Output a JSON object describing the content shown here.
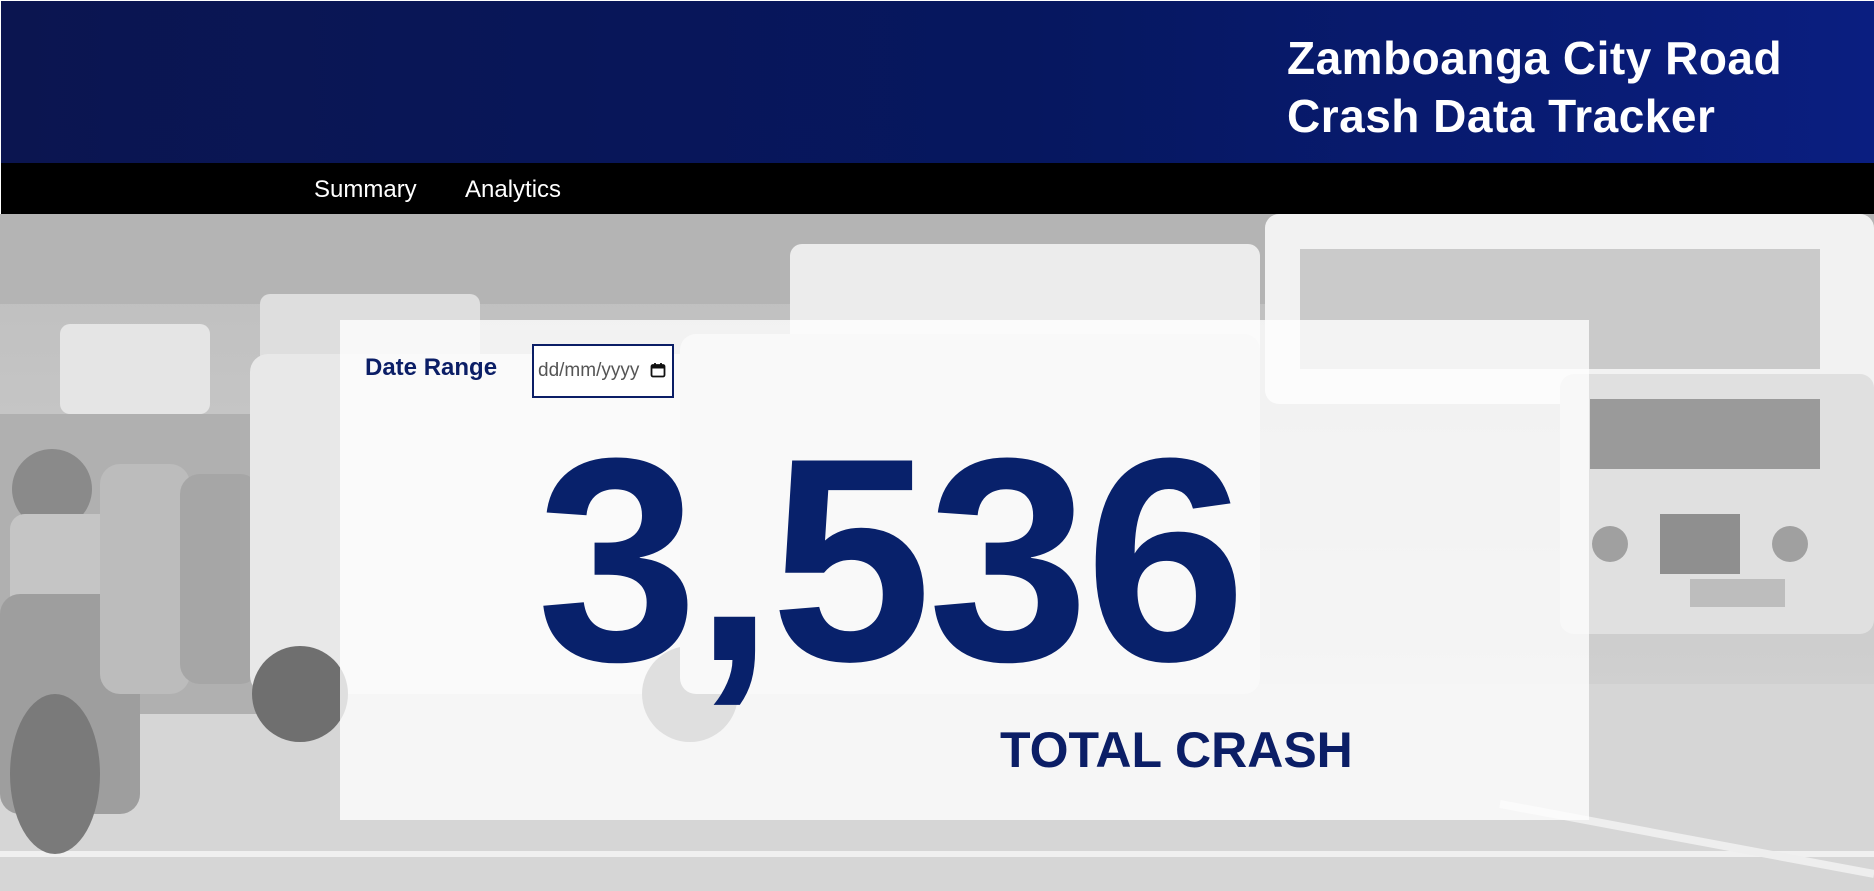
{
  "header": {
    "title_line1": "Zamboanga City Road",
    "title_line2": "Crash Data Tracker"
  },
  "nav": {
    "items": [
      {
        "label": "Summary"
      },
      {
        "label": "Analytics"
      }
    ]
  },
  "filter": {
    "date_label": "Date Range",
    "date_placeholder": "dd/mm/yyyy"
  },
  "stats": {
    "total_value": "3,536",
    "total_label": "TOTAL CRASH"
  },
  "colors": {
    "header_bg": "#06175f",
    "nav_bg": "#000000",
    "accent": "#08216b"
  },
  "icons": {
    "calendar": "calendar-icon"
  }
}
